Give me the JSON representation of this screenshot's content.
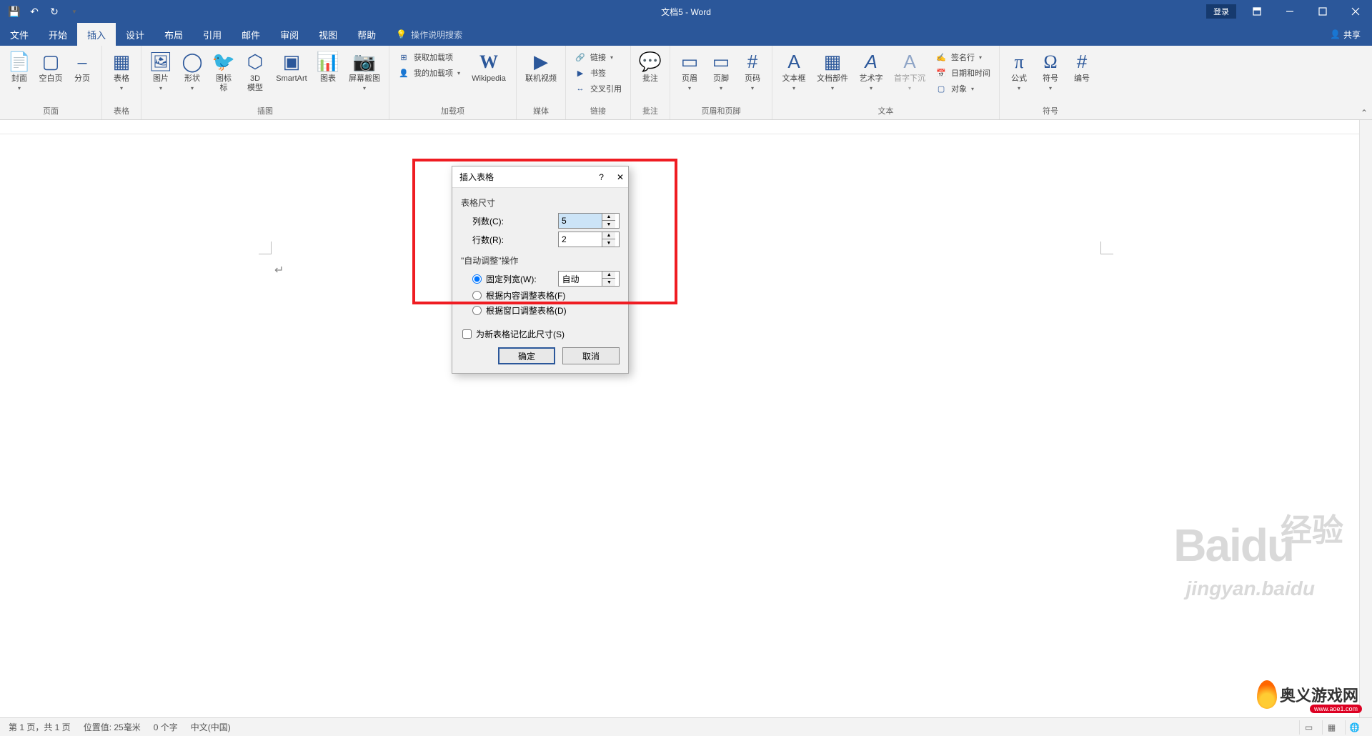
{
  "titlebar": {
    "title": "文档5 - Word",
    "login": "登录"
  },
  "menubar": {
    "tabs": [
      "文件",
      "开始",
      "插入",
      "设计",
      "布局",
      "引用",
      "邮件",
      "审阅",
      "视图",
      "帮助"
    ],
    "active_index": 2,
    "tell_me": "操作说明搜索",
    "share": "共享"
  },
  "ribbon": {
    "groups": {
      "pages": {
        "label": "页面",
        "cover": "封面",
        "blank": "空白页",
        "break": "分页"
      },
      "tables": {
        "label": "表格",
        "table": "表格"
      },
      "illus": {
        "label": "插图",
        "picture": "图片",
        "shapes": "形状",
        "icons": "图标",
        "model3d": "3D\n模型",
        "smartart": "SmartArt",
        "chart": "图表",
        "screenshot": "屏幕截图"
      },
      "addins": {
        "label": "加载项",
        "get": "获取加载项",
        "my": "我的加载项",
        "wikipedia": "Wikipedia"
      },
      "media": {
        "label": "媒体",
        "video": "联机视频"
      },
      "links": {
        "label": "链接",
        "link": "链接",
        "bookmark": "书签",
        "crossref": "交叉引用"
      },
      "comments": {
        "label": "批注",
        "comment": "批注"
      },
      "headerfooter": {
        "label": "页眉和页脚",
        "header": "页眉",
        "footer": "页脚",
        "pagenum": "页码"
      },
      "text": {
        "label": "文本",
        "textbox": "文本框",
        "quickparts": "文档部件",
        "wordart": "艺术字",
        "dropcap": "首字下沉",
        "sigline": "签名行",
        "datetime": "日期和时间",
        "object": "对象"
      },
      "symbols": {
        "label": "符号",
        "equation": "公式",
        "symbol": "符号",
        "number": "编号"
      }
    }
  },
  "dialog": {
    "title": "插入表格",
    "section_size": "表格尺寸",
    "columns_label": "列数(C):",
    "columns_value": "5",
    "rows_label": "行数(R):",
    "rows_value": "2",
    "section_auto": "\"自动调整\"操作",
    "fixed_label": "固定列宽(W):",
    "fixed_value": "自动",
    "fit_content": "根据内容调整表格(F)",
    "fit_window": "根据窗口调整表格(D)",
    "remember": "为新表格记忆此尺寸(S)",
    "ok": "确定",
    "cancel": "取消"
  },
  "statusbar": {
    "page": "第 1 页，共 1 页",
    "position": "位置值: 25毫米",
    "words": "0 个字",
    "lang": "中文(中国)"
  },
  "watermark": {
    "baidu": "Baidu",
    "jingyan_cn": "经验",
    "jingyan_url": "jingyan.baidu",
    "aoe": "奥义游戏网",
    "aoe_url": "www.aoe1.com"
  }
}
